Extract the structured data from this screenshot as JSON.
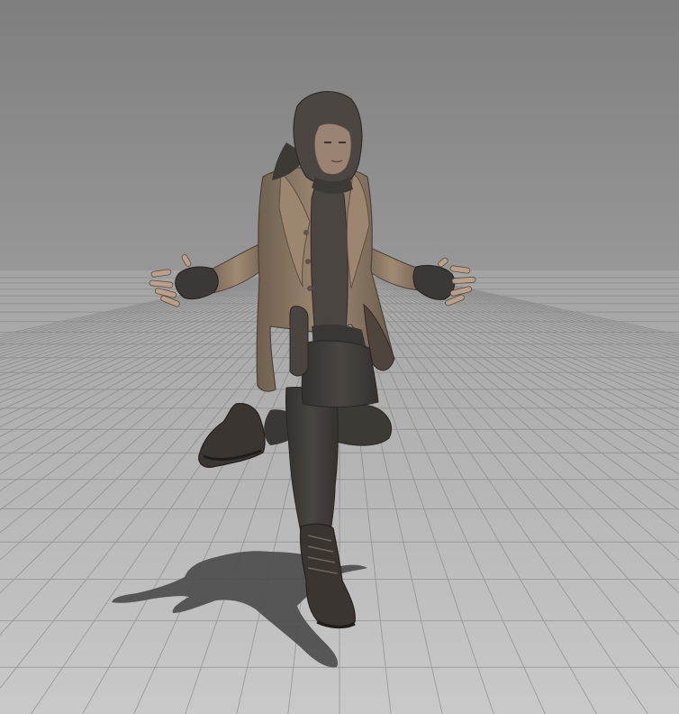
{
  "scene": {
    "type": "3d-character-viewport",
    "colors": {
      "sky_top": "#7e7e7e",
      "sky_horizon": "#9a9a9a",
      "floor_far": "#a4a4a4",
      "floor_near": "#c9c9c9",
      "grid_line": "#7d7d7d",
      "shadow": "#4a4a4a",
      "coat": "#8d7a66",
      "coat_shade": "#5c4f43",
      "hood": "#4b4641",
      "shirt": "#4a4541",
      "pants": "#3f3b37",
      "boots": "#3a3531",
      "gloves": "#3c3835",
      "skin": "#9a8373"
    },
    "icons": {
      "character": "character-figure-icon",
      "shadow": "character-shadow-icon",
      "grid": "ground-grid-icon"
    }
  }
}
